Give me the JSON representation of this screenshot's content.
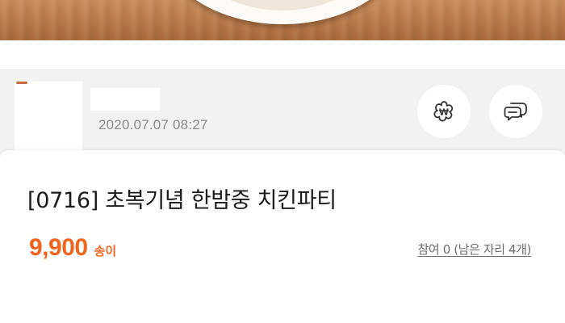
{
  "author": {
    "date": "2020.07.07 08:27"
  },
  "actions": {
    "like_icon": "flower-badge-icon",
    "comment_icon": "chat-bubbles-icon"
  },
  "post": {
    "title": "[0716] 초복기념 한밤중 치킨파티",
    "price": "9,900",
    "price_unit": "송이",
    "participation": "참여 0 (남은 자리 4개)"
  },
  "colors": {
    "accent": "#f0641e",
    "muted_text": "#8a8a8a",
    "header_bg": "#f2f2f2"
  }
}
